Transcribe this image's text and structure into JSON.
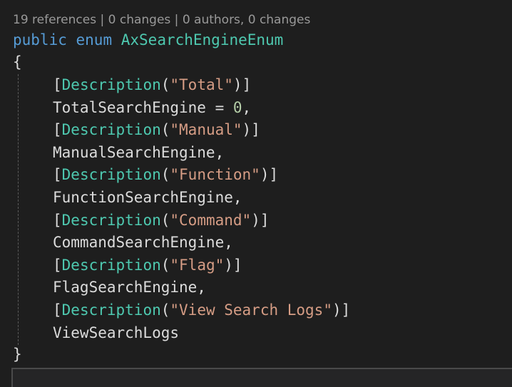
{
  "codelens": {
    "references": "19 references",
    "changes": "0 changes",
    "authors": "0 authors, 0 changes",
    "separator": "|"
  },
  "code": {
    "kw_public": "public",
    "kw_enum": "enum",
    "enum_name": "AxSearchEngineEnum",
    "open_brace": "{",
    "close_brace": "}",
    "attr_name": "Description",
    "members": [
      {
        "desc": "\"Total\"",
        "name": "TotalSearchEngine",
        "suffix": " = ",
        "value": "0",
        "end": ","
      },
      {
        "desc": "\"Manual\"",
        "name": "ManualSearchEngine",
        "end": ","
      },
      {
        "desc": "\"Function\"",
        "name": "FunctionSearchEngine",
        "end": ","
      },
      {
        "desc": "\"Command\"",
        "name": "CommandSearchEngine",
        "end": ","
      },
      {
        "desc": "\"Flag\"",
        "name": "FlagSearchEngine",
        "end": ","
      },
      {
        "desc": "\"View Search Logs\"",
        "name": "ViewSearchLogs",
        "end": ""
      }
    ]
  },
  "colors": {
    "background": "#1e1e1e",
    "keyword": "#569cd6",
    "type": "#4ec9b0",
    "string": "#d69d85",
    "number": "#b5cea8",
    "text": "#dcdcdc",
    "codelens": "#999999"
  }
}
